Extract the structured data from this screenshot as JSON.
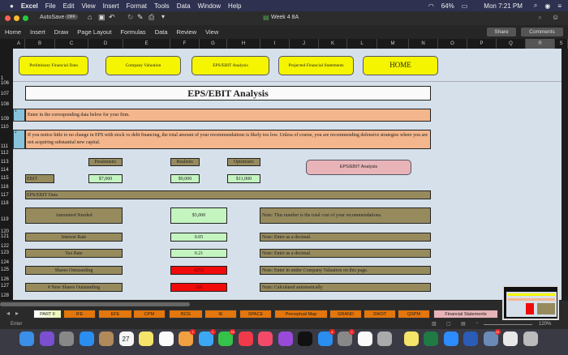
{
  "menubar": {
    "apple": "",
    "app": "Excel",
    "items": [
      "File",
      "Edit",
      "View",
      "Insert",
      "Format",
      "Tools",
      "Data",
      "Window",
      "Help"
    ],
    "battery": "64%",
    "clock": "Mon 7:21 PM"
  },
  "titlebar": {
    "autosave": "AutoSave",
    "autosave_state": "OFF",
    "doc_title": "Week 4 8A"
  },
  "ribbon": {
    "tabs": [
      "Home",
      "Insert",
      "Draw",
      "Page Layout",
      "Formulas",
      "Data",
      "Review",
      "View"
    ],
    "share": "Share",
    "comments": "Comments"
  },
  "columns": [
    "A",
    "B",
    "C",
    "D",
    "E",
    "F",
    "G",
    "H",
    "I",
    "J",
    "K",
    "L",
    "M",
    "N",
    "O",
    "P",
    "Q",
    "R",
    "S"
  ],
  "rows": [
    "1",
    "106",
    "107",
    "108",
    "109",
    "110",
    "111",
    "112",
    "113",
    "114",
    "115",
    "116",
    "117",
    "118",
    "119",
    "120",
    "121",
    "122",
    "123",
    "124",
    "125",
    "126",
    "127",
    "128"
  ],
  "nav_buttons": [
    "Preliminary Financial Data",
    "Company Valuation",
    "EPS/EBIT Analysis",
    "Projected Financial Statements",
    "HOME"
  ],
  "title": "EPS/EBIT Analysis",
  "instructions": [
    {
      "num": "1",
      "text": "Enter in the corresponding data below for your firm."
    },
    {
      "num": "2",
      "text": "If you notice little to no change in EPS with stock vs debt financing, the total amount of your recommendations is likely too low. Unless of course, you are recommending defensive strategies where you are not acquiring substantial new capital."
    }
  ],
  "scenarios": {
    "headers": [
      "Pessimistic",
      "Realistic",
      "Optimistic"
    ],
    "ebit_label": "EBIT",
    "ebit_values": [
      "$7,000",
      "$9,000",
      "$11,000"
    ]
  },
  "chart_button": "EPS/EBIT Analysis",
  "section_header": "EPS/EBIT Data",
  "data_rows": [
    {
      "label": "Amounted Needed",
      "value": "$5,000",
      "note": "Note: This number is the total cost of your recommendations.",
      "status": "input"
    },
    {
      "label": "Interest Rate",
      "value": "0.05",
      "note": "Note: Enter as a decimal.",
      "status": "input"
    },
    {
      "label": "Tax Rate",
      "value": "0.21",
      "note": "Note: Enter as a decimal.",
      "status": "input"
    },
    {
      "label": "Shares Outstanding",
      "value": "4255",
      "note": "Note: Enter in under Company Valuation on this page.",
      "status": "calc"
    },
    {
      "label": "# New Shares Outstanding",
      "value": "110",
      "note": "Note: Calculated automatically",
      "status": "calc"
    }
  ],
  "sheet_tabs": [
    "PART II",
    "IFE",
    "EFE",
    "CPM",
    "BCG",
    "IE",
    "SPACE",
    "Perceptual Map",
    "GRAND",
    "SWOT",
    "QSPM",
    "Financial Statements"
  ],
  "status": {
    "mode": "Enter",
    "zoom": "120%"
  },
  "dock_badges": {
    "photos": "2",
    "messages": "1",
    "facetime": "33",
    "appstore": "4",
    "prefs": "2",
    "calendar": "27",
    "preview": "10"
  },
  "colors": {
    "yellow": "#f5f500",
    "olive": "#978b5e",
    "green": "#c4f5c0",
    "red": "#f00a0a",
    "orange_note": "#f4b68c",
    "tab_orange": "#e3760c"
  }
}
